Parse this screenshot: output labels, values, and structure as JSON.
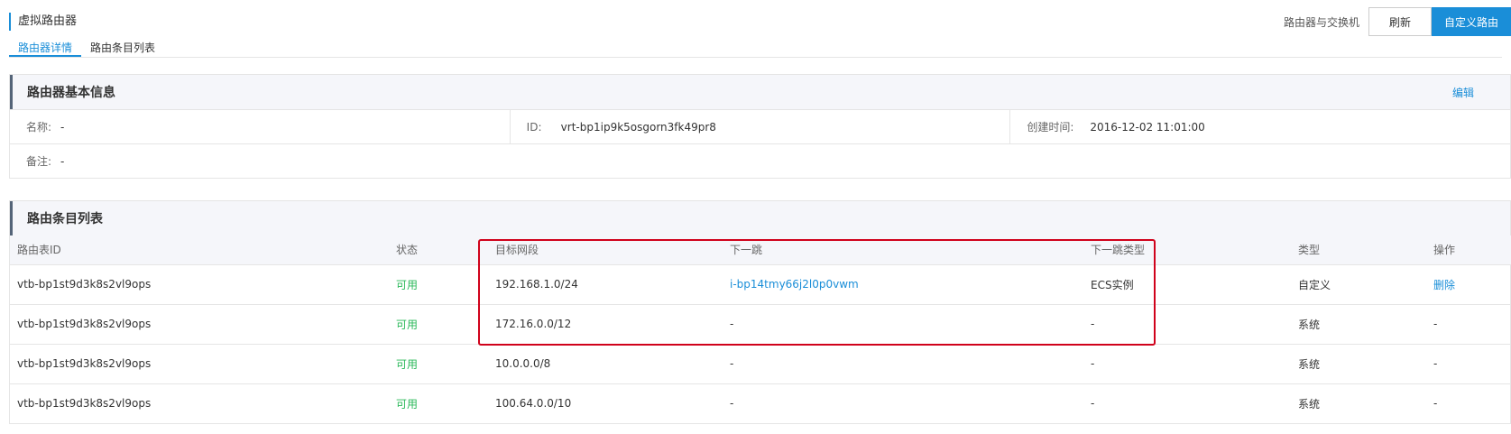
{
  "header": {
    "title": "虚拟路由器",
    "hint": "路由器与交换机",
    "refresh_label": "刷新",
    "primary_button": "自定义路由"
  },
  "tabs": [
    {
      "label": "路由器详情"
    },
    {
      "label": "路由条目列表"
    }
  ],
  "basic_info": {
    "title": "路由器基本信息",
    "edit_label": "编辑",
    "name_label": "名称:",
    "name_value": "-",
    "id_label": "ID:",
    "id_value": "vrt-bp1ip9k5osgorn3fk49pr8",
    "created_label": "创建时间:",
    "created_value": "2016-12-02 11:01:00",
    "desc_label": "备注:",
    "desc_value": "-"
  },
  "route_table": {
    "title": "路由条目列表",
    "columns": [
      "路由表ID",
      "状态",
      "目标网段",
      "下一跳",
      "下一跳类型",
      "类型",
      "操作"
    ],
    "rows": [
      {
        "id": "vtb-bp1st9d3k8s2vl9ops",
        "status": "可用",
        "cidr": "192.168.1.0/24",
        "next_hop": "i-bp14tmy66j2l0p0vwm",
        "hop_type": "ECS实例",
        "type": "自定义",
        "action": "删除"
      },
      {
        "id": "vtb-bp1st9d3k8s2vl9ops",
        "status": "可用",
        "cidr": "172.16.0.0/12",
        "next_hop": "-",
        "hop_type": "-",
        "type": "系统",
        "action": "-"
      },
      {
        "id": "vtb-bp1st9d3k8s2vl9ops",
        "status": "可用",
        "cidr": "10.0.0.0/8",
        "next_hop": "-",
        "hop_type": "-",
        "type": "系统",
        "action": "-"
      },
      {
        "id": "vtb-bp1st9d3k8s2vl9ops",
        "status": "可用",
        "cidr": "100.64.0.0/10",
        "next_hop": "-",
        "hop_type": "-",
        "type": "系统",
        "action": "-"
      }
    ]
  },
  "colors": {
    "accent": "#1a8ed8",
    "highlight": "#d0021b",
    "status_ok": "#2ab859"
  }
}
